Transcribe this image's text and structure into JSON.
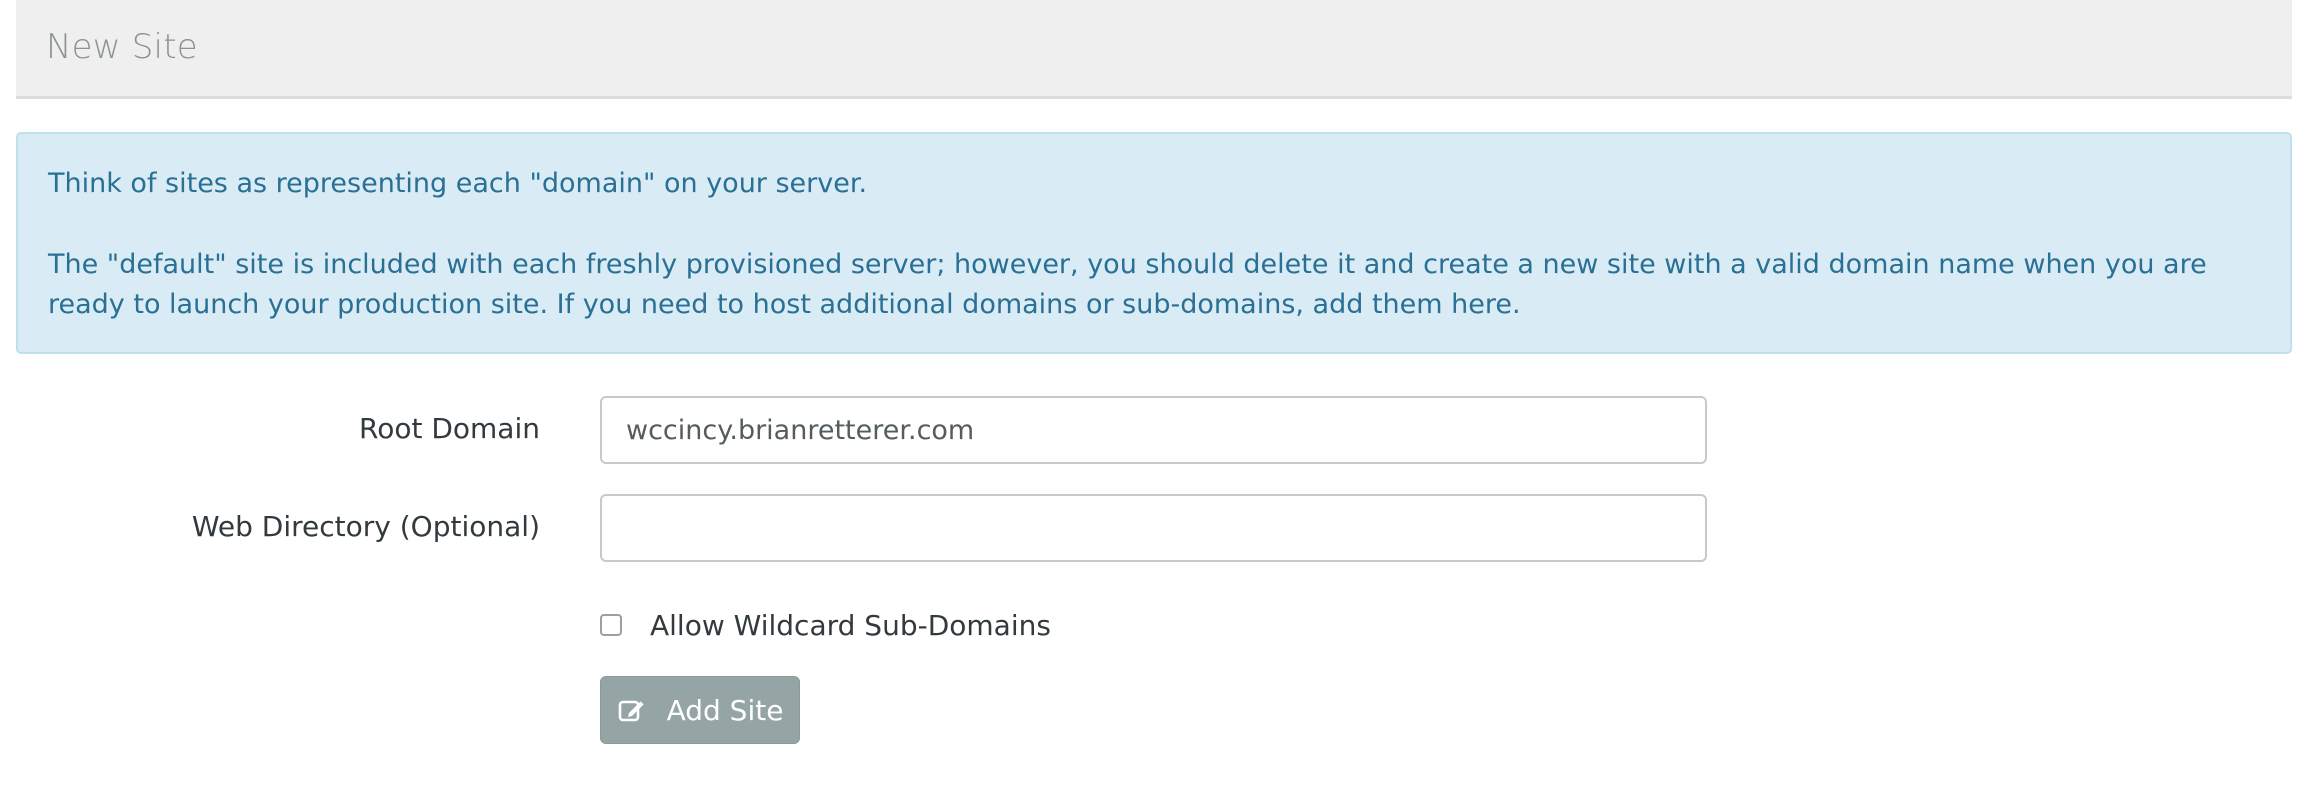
{
  "header": {
    "title": "New Site"
  },
  "alert": {
    "line1": "Think of sites as representing each \"domain\" on your server.",
    "line2": "The \"default\" site is included with each freshly provisioned server; however, you should delete it and create a new site with a valid domain name when you are ready to launch your production site. If you need to host additional domains or sub-domains, add them here."
  },
  "form": {
    "root_domain_label": "Root Domain",
    "root_domain_value": "wccincy.brianretterer.com",
    "web_directory_label": "Web Directory (Optional)",
    "web_directory_value": "",
    "wildcard_label": "Allow Wildcard Sub-Domains",
    "wildcard_checked": false,
    "submit_label": "Add Site",
    "submit_icon": "edit-icon"
  },
  "colors": {
    "alert_text": "#2a6f94",
    "alert_bg": "#d9ecf5",
    "button_bg": "#95a5a6"
  }
}
